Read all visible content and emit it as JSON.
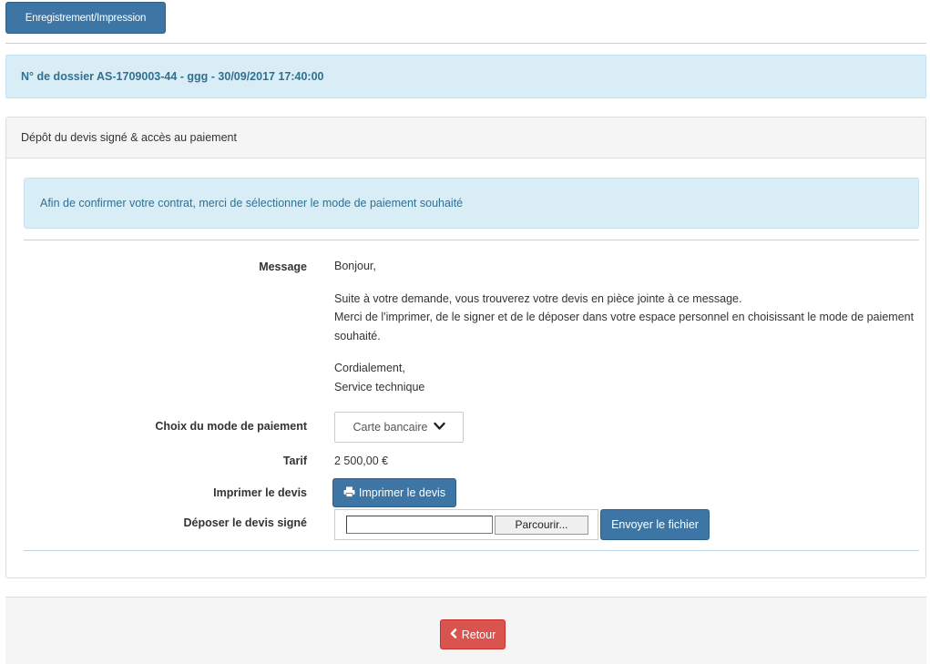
{
  "toolbar": {
    "save_print_label": "Enregistrement/Impression"
  },
  "dossier": {
    "title": "N° de dossier AS-1709003-44 - ggg - 30/09/2017 17:40:00"
  },
  "panel": {
    "heading": "Dépôt du devis signé & accès au paiement",
    "info": "Afin de confirmer votre contrat, merci de sélectionner le mode de paiement souhaité"
  },
  "form": {
    "message_label": "Message",
    "message_lines": [
      "Bonjour,",
      "Suite à votre demande, vous trouverez votre devis en pièce jointe à ce message.",
      "Merci de l'imprimer, de le signer et de le déposer dans votre espace personnel en choisissant le mode de paiement souhaité.",
      "Cordialement,",
      "Service technique"
    ],
    "payment_label": "Choix du mode de paiement",
    "payment_selected": "Carte bancaire",
    "tarif_label": "Tarif",
    "tarif_value": "2 500,00 €",
    "print_label": "Imprimer le devis",
    "print_button": "Imprimer le devis",
    "upload_label": "Déposer le devis signé",
    "browse_button": "Parcourir...",
    "send_button": "Envoyer le fichier"
  },
  "footer": {
    "back_button": "Retour"
  },
  "icons": {
    "select_arrow": "chevron-down-icon",
    "print": "printer-icon",
    "back": "chevron-left-icon"
  },
  "colors": {
    "primary": "#3d76a4",
    "info_bg": "#d9edf7",
    "info_text": "#31708f",
    "danger": "#d9534f"
  }
}
